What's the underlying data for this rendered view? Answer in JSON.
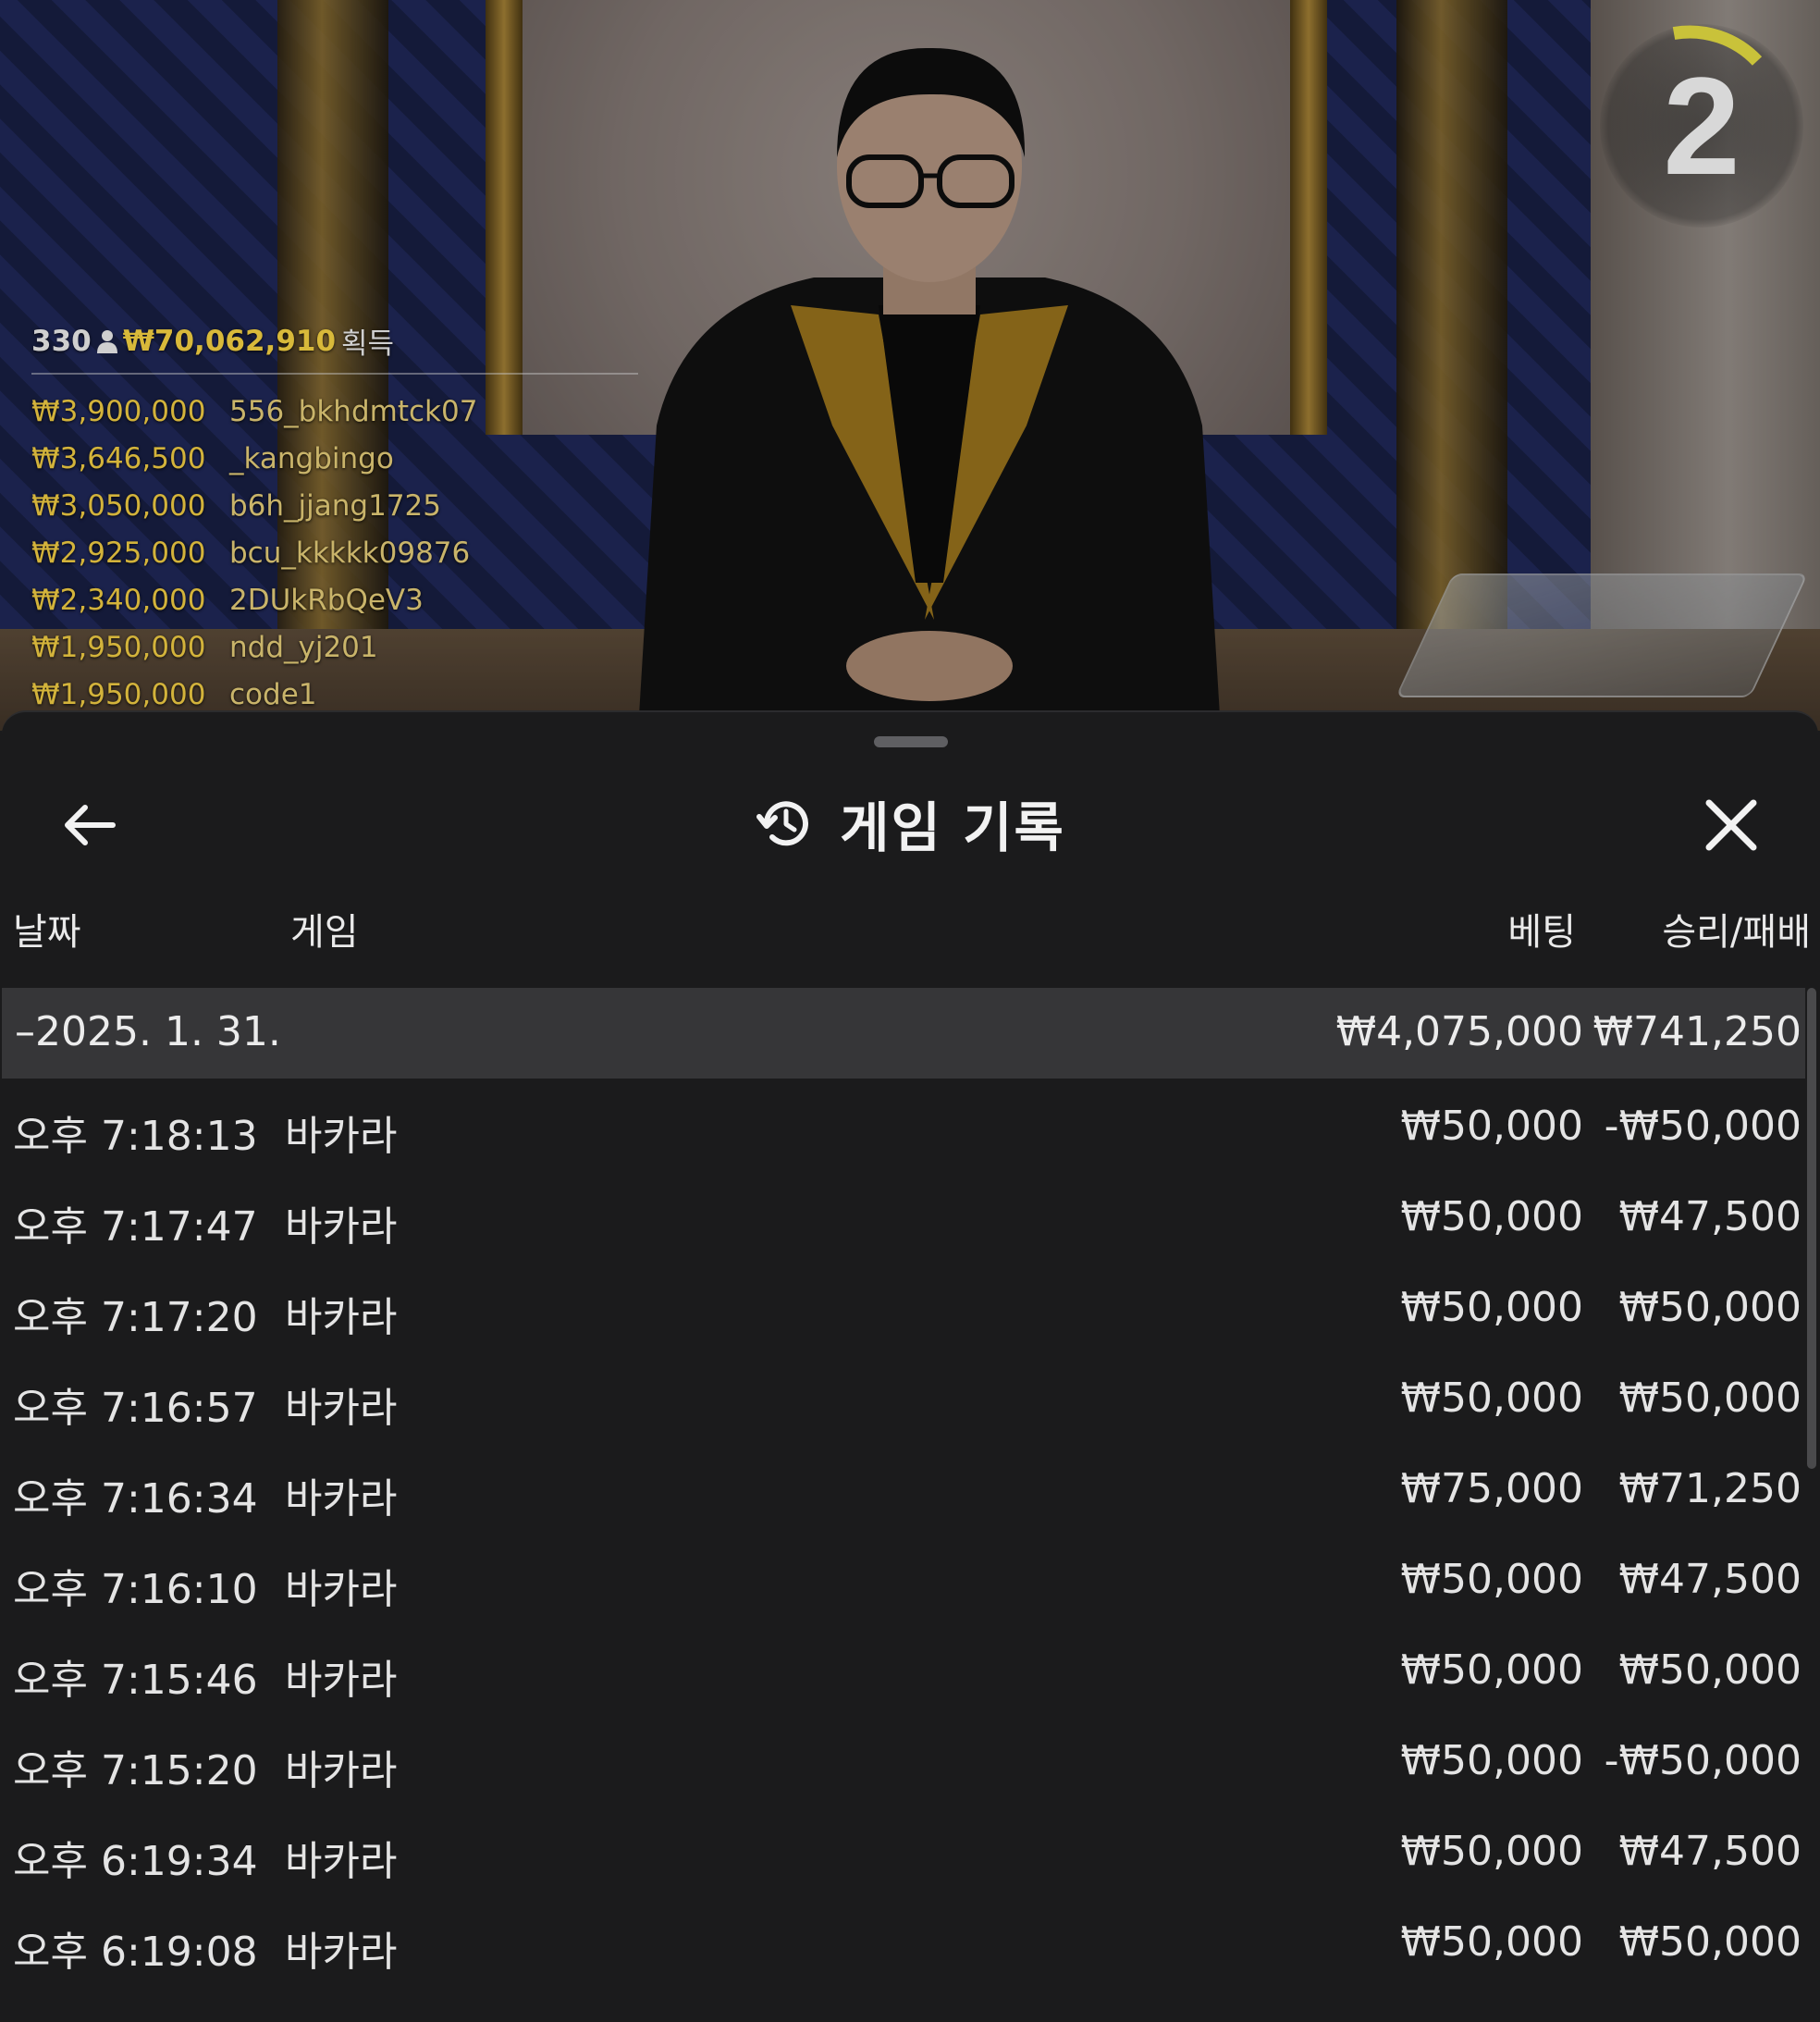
{
  "timer": {
    "value": "2"
  },
  "winners": {
    "count": "330",
    "total": "₩70,062,910",
    "suffix": "획득",
    "list": [
      {
        "amount": "₩3,900,000",
        "user": "556_bkhdmtck07"
      },
      {
        "amount": "₩3,646,500",
        "user": "_kangbingo"
      },
      {
        "amount": "₩3,050,000",
        "user": "b6h_jjang1725"
      },
      {
        "amount": "₩2,925,000",
        "user": "bcu_kkkkk09876"
      },
      {
        "amount": "₩2,340,000",
        "user": "2DUkRbQeV3"
      },
      {
        "amount": "₩1,950,000",
        "user": "ndd_yj201"
      },
      {
        "amount": "₩1,950,000",
        "user": "code1"
      }
    ]
  },
  "sheet": {
    "title": "게임 기록",
    "columns": {
      "date": "날짜",
      "game": "게임",
      "bet": "베팅",
      "result": "승리/패배"
    },
    "group": {
      "date": "–2025. 1. 31.",
      "bet": "₩4,075,000",
      "result": "₩741,250"
    },
    "rows": [
      {
        "time": "오후 7:18:13",
        "game": "바카라",
        "bet": "₩50,000",
        "result": "-₩50,000"
      },
      {
        "time": "오후 7:17:47",
        "game": "바카라",
        "bet": "₩50,000",
        "result": "₩47,500"
      },
      {
        "time": "오후 7:17:20",
        "game": "바카라",
        "bet": "₩50,000",
        "result": "₩50,000"
      },
      {
        "time": "오후 7:16:57",
        "game": "바카라",
        "bet": "₩50,000",
        "result": "₩50,000"
      },
      {
        "time": "오후 7:16:34",
        "game": "바카라",
        "bet": "₩75,000",
        "result": "₩71,250"
      },
      {
        "time": "오후 7:16:10",
        "game": "바카라",
        "bet": "₩50,000",
        "result": "₩47,500"
      },
      {
        "time": "오후 7:15:46",
        "game": "바카라",
        "bet": "₩50,000",
        "result": "₩50,000"
      },
      {
        "time": "오후 7:15:20",
        "game": "바카라",
        "bet": "₩50,000",
        "result": "-₩50,000"
      },
      {
        "time": "오후 6:19:34",
        "game": "바카라",
        "bet": "₩50,000",
        "result": "₩47,500"
      },
      {
        "time": "오후 6:19:08",
        "game": "바카라",
        "bet": "₩50,000",
        "result": "₩50,000"
      }
    ]
  },
  "icons": {
    "back": "arrow-left-icon",
    "history": "history-icon",
    "close": "close-icon",
    "user": "person-icon"
  },
  "colors": {
    "accent_gold": "#d8b93a",
    "sheet_bg": "#1b1b1c",
    "group_bg": "#363638"
  }
}
